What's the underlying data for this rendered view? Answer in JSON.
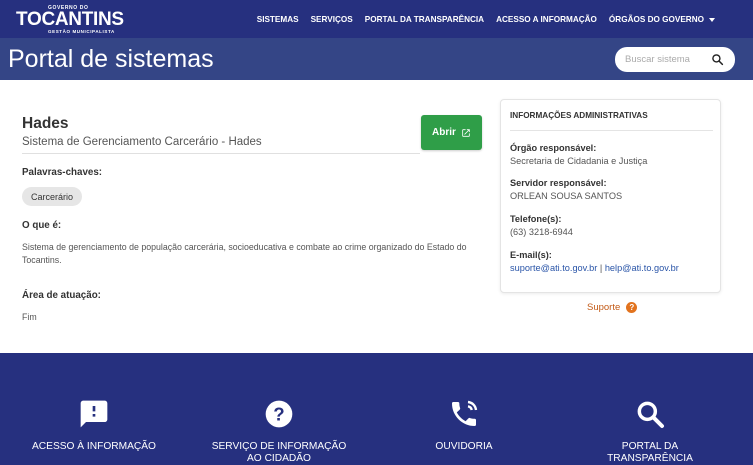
{
  "logo": {
    "line1": "GOVERNO DO",
    "line2": "TOCANTINS",
    "line3": "GESTÃO MUNICIPALISTA"
  },
  "nav": {
    "items": [
      "SISTEMAS",
      "SERVIÇOS",
      "PORTAL DA TRANSPARÊNCIA",
      "ACESSO A INFORMAÇÃO",
      "ÓRGÃOS DO GOVERNO"
    ]
  },
  "header": {
    "title": "Portal de sistemas",
    "search_placeholder": "Buscar sistema"
  },
  "system": {
    "name": "Hades",
    "description": "Sistema de Gerenciamento Carcerário - Hades",
    "open_label": "Abrir",
    "keywords_label": "Palavras-chaves:",
    "keywords": [
      "Carcerário"
    ],
    "what_label": "O que é:",
    "what_text": "Sistema de gerenciamento de população carcerária, socioeducativa e combate ao crime organizado do Estado do Tocantins.",
    "area_label": "Área de atuação:",
    "area_value": "Fim"
  },
  "admin": {
    "title": "INFORMAÇÕES ADMINISTRATIVAS",
    "org_label": "Órgão responsável:",
    "org_value": "Secretaria de Cidadania e Justiça",
    "server_label": "Servidor responsável:",
    "server_value": "ORLEAN SOUSA SANTOS",
    "phone_label": "Telefone(s):",
    "phone_value": "(63) 3218-6944",
    "email_label": "E-mail(s):",
    "emails": [
      "suporte@ati.to.gov.br",
      "help@ati.to.gov.br"
    ],
    "email_separator": "|"
  },
  "support": {
    "label": "Suporte",
    "icon": "?"
  },
  "footer": {
    "items": [
      {
        "label": "ACESSO À INFORMAÇÃO",
        "icon": "info-alert-icon"
      },
      {
        "label": "SERVIÇO DE INFORMAÇÃO AO CIDADÃO",
        "icon": "question-icon"
      },
      {
        "label": "OUVIDORIA",
        "icon": "phone-icon"
      },
      {
        "label": "PORTAL DA TRANSPARÊNCIA",
        "icon": "search-icon"
      }
    ]
  },
  "colors": {
    "nav_bg": "#26307f",
    "title_bg": "#344586",
    "open_button": "#2f9e48",
    "support": "#c35a16",
    "link": "#2a55a8"
  }
}
